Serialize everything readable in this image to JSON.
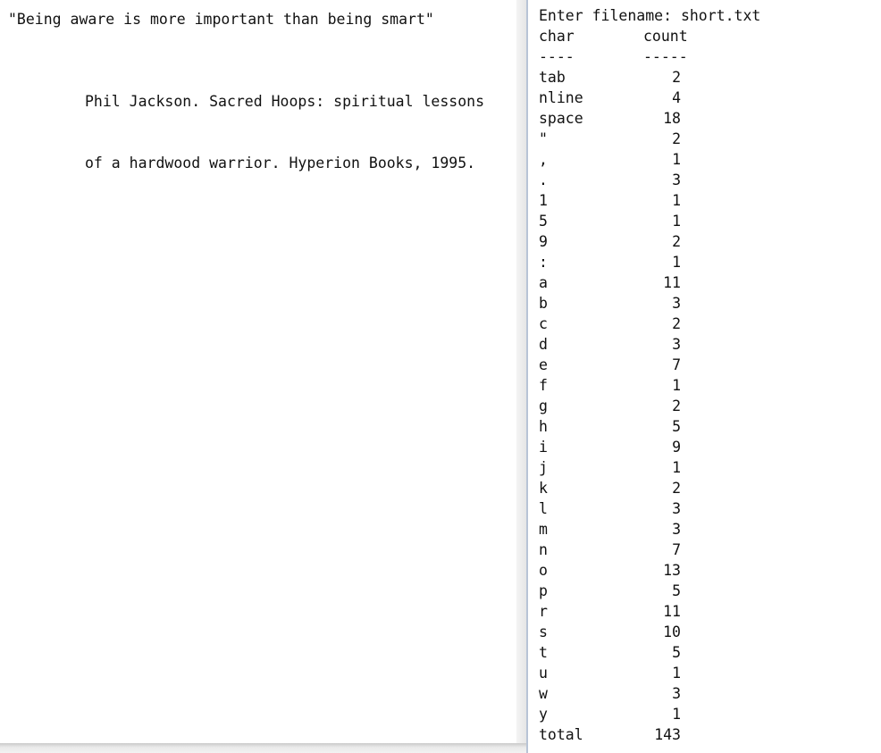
{
  "left": {
    "quote": "\"Being aware is more important than being smart\"",
    "citation_lines": [
      "Phil Jackson. Sacred Hoops: spiritual lessons",
      "of a hardwood warrior. Hyperion Books, 1995."
    ]
  },
  "console": {
    "prompt": "Enter filename: short.txt",
    "headers": {
      "char": "char",
      "count": "count"
    },
    "separators": {
      "char": "----",
      "count": "-----"
    },
    "rows": [
      {
        "char": "tab",
        "count": "2"
      },
      {
        "char": "nline",
        "count": "4"
      },
      {
        "char": "space",
        "count": "18"
      },
      {
        "char": "\"",
        "count": "2"
      },
      {
        "char": ",",
        "count": "1"
      },
      {
        "char": ".",
        "count": "3"
      },
      {
        "char": "1",
        "count": "1"
      },
      {
        "char": "5",
        "count": "1"
      },
      {
        "char": "9",
        "count": "2"
      },
      {
        "char": ":",
        "count": "1"
      },
      {
        "char": "a",
        "count": "11"
      },
      {
        "char": "b",
        "count": "3"
      },
      {
        "char": "c",
        "count": "2"
      },
      {
        "char": "d",
        "count": "3"
      },
      {
        "char": "e",
        "count": "7"
      },
      {
        "char": "f",
        "count": "1"
      },
      {
        "char": "g",
        "count": "2"
      },
      {
        "char": "h",
        "count": "5"
      },
      {
        "char": "i",
        "count": "9"
      },
      {
        "char": "j",
        "count": "1"
      },
      {
        "char": "k",
        "count": "2"
      },
      {
        "char": "l",
        "count": "3"
      },
      {
        "char": "m",
        "count": "3"
      },
      {
        "char": "n",
        "count": "7"
      },
      {
        "char": "o",
        "count": "13"
      },
      {
        "char": "p",
        "count": "5"
      },
      {
        "char": "r",
        "count": "11"
      },
      {
        "char": "s",
        "count": "10"
      },
      {
        "char": "t",
        "count": "5"
      },
      {
        "char": "u",
        "count": "1"
      },
      {
        "char": "w",
        "count": "3"
      },
      {
        "char": "y",
        "count": "1"
      }
    ],
    "total": {
      "label": "total",
      "count": "143"
    }
  }
}
